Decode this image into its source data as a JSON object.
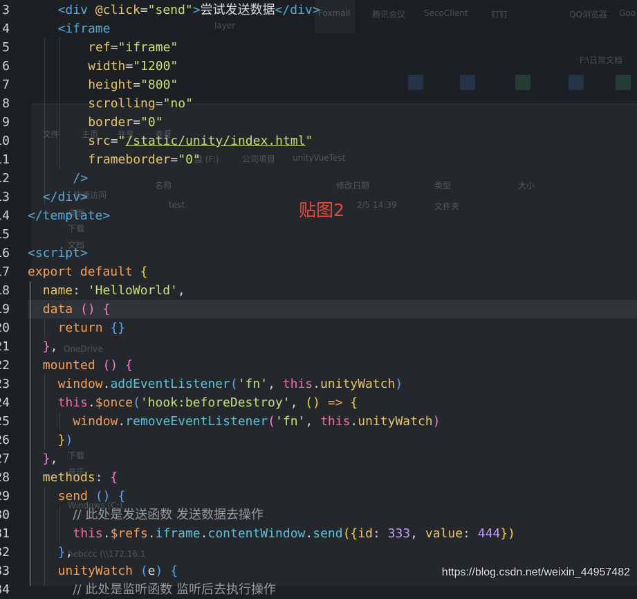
{
  "background": {
    "taskbar_apps": [
      "Foxmail",
      "腾讯会议",
      "SecoClient",
      "钉钉",
      "QQ浏览器",
      "Goo"
    ],
    "desktop_folder": "F:\\日常文档",
    "desktop_item": "layer",
    "explorer": {
      "ribbon_tabs": [
        "文件",
        "主页",
        "共享",
        "查看"
      ],
      "breadcrumb": [
        "盘 (F:)",
        "公司项目",
        "unityVueTest"
      ],
      "columns": [
        "名称",
        "修改日期",
        "类型",
        "大小"
      ],
      "rows": [
        {
          "name": "test",
          "date": "2/5 14:39",
          "type": "文件夹"
        }
      ],
      "sidebar": [
        "快速访问",
        "桌面",
        "下载",
        "文档",
        "OneDrive",
        "下载",
        "音乐",
        "Windows (C:)",
        "hebccc (\\\\172.16.1"
      ]
    }
  },
  "editor": {
    "lines": [
      {
        "n": "3",
        "indent": 2,
        "tokens": [
          [
            "t-tag",
            "<div "
          ],
          [
            "t-attr",
            "@click"
          ],
          [
            "t-plain",
            "="
          ],
          [
            "t-str",
            "\"send\""
          ],
          [
            "t-tag",
            ">"
          ],
          [
            "t-cn",
            "尝试发送数据"
          ],
          [
            "t-tag",
            "</div>"
          ]
        ]
      },
      {
        "n": "4",
        "indent": 2,
        "tokens": [
          [
            "t-tag",
            "<iframe"
          ]
        ]
      },
      {
        "n": "5",
        "indent": 4,
        "tokens": [
          [
            "t-attr",
            "ref"
          ],
          [
            "t-plain",
            "="
          ],
          [
            "t-str",
            "\"iframe\""
          ]
        ]
      },
      {
        "n": "6",
        "indent": 4,
        "tokens": [
          [
            "t-attr",
            "width"
          ],
          [
            "t-plain",
            "="
          ],
          [
            "t-str",
            "\"1200\""
          ]
        ]
      },
      {
        "n": "7",
        "indent": 4,
        "tokens": [
          [
            "t-attr",
            "height"
          ],
          [
            "t-plain",
            "="
          ],
          [
            "t-str",
            "\"800\""
          ]
        ]
      },
      {
        "n": "8",
        "indent": 4,
        "tokens": [
          [
            "t-attr",
            "scrolling"
          ],
          [
            "t-plain",
            "="
          ],
          [
            "t-str",
            "\"no\""
          ]
        ]
      },
      {
        "n": "9",
        "indent": 4,
        "tokens": [
          [
            "t-attr",
            "border"
          ],
          [
            "t-plain",
            "="
          ],
          [
            "t-str",
            "\"0\""
          ]
        ]
      },
      {
        "n": "10",
        "indent": 4,
        "tokens": [
          [
            "t-attr",
            "src"
          ],
          [
            "t-plain",
            "="
          ],
          [
            "t-str",
            "\""
          ],
          [
            "t-str t-ul",
            "/static/unity/index.html"
          ],
          [
            "t-str",
            "\""
          ]
        ]
      },
      {
        "n": "11",
        "indent": 4,
        "tokens": [
          [
            "t-attr",
            "frameborder"
          ],
          [
            "t-plain",
            "="
          ],
          [
            "t-str",
            "\"0\""
          ]
        ]
      },
      {
        "n": "12",
        "indent": 3,
        "tokens": [
          [
            "t-tag",
            "/>"
          ]
        ]
      },
      {
        "n": "13",
        "indent": 1,
        "tokens": [
          [
            "t-tag",
            "</div>"
          ]
        ]
      },
      {
        "n": "14",
        "indent": 0,
        "tokens": [
          [
            "t-tag",
            "</template>"
          ]
        ]
      },
      {
        "n": "15",
        "indent": 0,
        "tokens": []
      },
      {
        "n": "16",
        "indent": 0,
        "tokens": [
          [
            "t-tag",
            "<script>"
          ]
        ]
      },
      {
        "n": "17",
        "indent": 0,
        "tokens": [
          [
            "t-kw",
            "export default "
          ],
          [
            "t-brY",
            "{"
          ]
        ]
      },
      {
        "n": "18",
        "indent": 1,
        "tokens": [
          [
            "t-prop",
            "name"
          ],
          [
            "t-plain",
            ": "
          ],
          [
            "t-str",
            "'HelloWorld'"
          ],
          [
            "t-plain",
            ","
          ]
        ]
      },
      {
        "n": "19",
        "indent": 1,
        "tokens": [
          [
            "t-kw",
            "data "
          ],
          [
            "t-brP",
            "()"
          ],
          [
            "t-plain",
            " "
          ],
          [
            "t-brP",
            "{"
          ]
        ]
      },
      {
        "n": "20",
        "indent": 2,
        "tokens": [
          [
            "t-kw",
            "return "
          ],
          [
            "t-brB",
            "{}"
          ]
        ]
      },
      {
        "n": "21",
        "indent": 1,
        "tokens": [
          [
            "t-brP",
            "}"
          ],
          [
            "t-plain",
            ","
          ]
        ]
      },
      {
        "n": "22",
        "indent": 1,
        "tokens": [
          [
            "t-kw",
            "mounted "
          ],
          [
            "t-brP",
            "()"
          ],
          [
            "t-plain",
            " "
          ],
          [
            "t-brP",
            "{"
          ]
        ]
      },
      {
        "n": "23",
        "indent": 2,
        "tokens": [
          [
            "t-kw",
            "window"
          ],
          [
            "t-plain",
            "."
          ],
          [
            "t-fn",
            "addEventListener"
          ],
          [
            "t-brB",
            "("
          ],
          [
            "t-str",
            "'fn'"
          ],
          [
            "t-plain",
            ", "
          ],
          [
            "t-this",
            "this"
          ],
          [
            "t-plain",
            "."
          ],
          [
            "t-prop",
            "unityWatch"
          ],
          [
            "t-brB",
            ")"
          ]
        ]
      },
      {
        "n": "24",
        "indent": 2,
        "tokens": [
          [
            "t-this",
            "this"
          ],
          [
            "t-plain",
            "."
          ],
          [
            "t-kw",
            "$once"
          ],
          [
            "t-brB",
            "("
          ],
          [
            "t-str",
            "'hook:beforeDestroy'"
          ],
          [
            "t-plain",
            ", "
          ],
          [
            "t-brY",
            "()"
          ],
          [
            "t-plain",
            " "
          ],
          [
            "t-kw",
            "=>"
          ],
          [
            "t-plain",
            " "
          ],
          [
            "t-brY",
            "{"
          ]
        ]
      },
      {
        "n": "25",
        "indent": 3,
        "tokens": [
          [
            "t-kw",
            "window"
          ],
          [
            "t-plain",
            "."
          ],
          [
            "t-fn",
            "removeEventListener"
          ],
          [
            "t-brP",
            "("
          ],
          [
            "t-str",
            "'fn'"
          ],
          [
            "t-plain",
            ", "
          ],
          [
            "t-this",
            "this"
          ],
          [
            "t-plain",
            "."
          ],
          [
            "t-prop",
            "unityWatch"
          ],
          [
            "t-brP",
            ")"
          ]
        ]
      },
      {
        "n": "26",
        "indent": 2,
        "tokens": [
          [
            "t-brY",
            "}"
          ],
          [
            "t-brB",
            ")"
          ]
        ]
      },
      {
        "n": "27",
        "indent": 1,
        "tokens": [
          [
            "t-brP",
            "}"
          ],
          [
            "t-plain",
            ","
          ]
        ]
      },
      {
        "n": "28",
        "indent": 1,
        "tokens": [
          [
            "t-prop",
            "methods"
          ],
          [
            "t-plain",
            ": "
          ],
          [
            "t-brP",
            "{"
          ]
        ]
      },
      {
        "n": "29",
        "indent": 2,
        "tokens": [
          [
            "t-kw",
            "send "
          ],
          [
            "t-brB",
            "()"
          ],
          [
            "t-plain",
            " "
          ],
          [
            "t-brB",
            "{"
          ]
        ]
      },
      {
        "n": "30",
        "indent": 3,
        "tokens": [
          [
            "t-cm",
            "// 此处是发送函数 发送数据去操作"
          ]
        ]
      },
      {
        "n": "31",
        "indent": 3,
        "tokens": [
          [
            "t-this",
            "this"
          ],
          [
            "t-plain",
            "."
          ],
          [
            "t-kw",
            "$refs"
          ],
          [
            "t-plain",
            "."
          ],
          [
            "t-fn",
            "iframe"
          ],
          [
            "t-plain",
            "."
          ],
          [
            "t-fn",
            "contentWindow"
          ],
          [
            "t-plain",
            "."
          ],
          [
            "t-fn",
            "send"
          ],
          [
            "t-brY",
            "({"
          ],
          [
            "t-prop",
            "id"
          ],
          [
            "t-plain",
            ": "
          ],
          [
            "t-num",
            "333"
          ],
          [
            "t-plain",
            ", "
          ],
          [
            "t-prop",
            "value"
          ],
          [
            "t-plain",
            ": "
          ],
          [
            "t-num",
            "444"
          ],
          [
            "t-brY",
            "})"
          ]
        ]
      },
      {
        "n": "32",
        "indent": 2,
        "tokens": [
          [
            "t-brB",
            "}"
          ],
          [
            "t-plain",
            ","
          ]
        ]
      },
      {
        "n": "33",
        "indent": 2,
        "tokens": [
          [
            "t-kw",
            "unityWatch "
          ],
          [
            "t-brB",
            "("
          ],
          [
            "t-plain",
            "e"
          ],
          [
            "t-brB",
            ")"
          ],
          [
            "t-plain",
            " "
          ],
          [
            "t-brB",
            "{"
          ]
        ]
      },
      {
        "n": "34",
        "indent": 3,
        "tokens": [
          [
            "t-cm",
            "// 此处是监听函数 监听后去执行操作"
          ]
        ]
      }
    ]
  },
  "overlay": {
    "label_cn": "贴图2",
    "watermark": "https://blog.csdn.net/weixin_44957482"
  }
}
